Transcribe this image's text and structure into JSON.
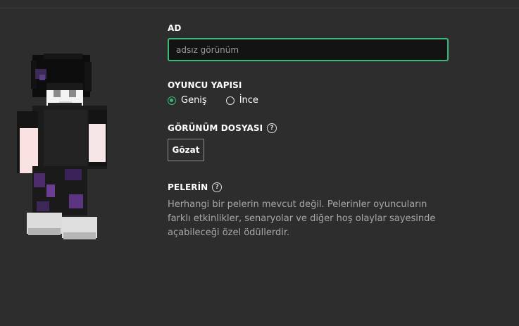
{
  "form": {
    "name_label": "AD",
    "name_placeholder": "adsız görünüm",
    "player_model_label": "OYUNCU YAPISI",
    "model_options": [
      {
        "label": "Geniş",
        "selected": true
      },
      {
        "label": "İnce",
        "selected": false
      }
    ],
    "skin_file_label": "GÖRÜNÜM DOSYASI",
    "browse_label": "Gözat",
    "cape_label": "PELERİN",
    "cape_description": "Herhangi bir pelerin mevcut değil. Pelerinler oyuncuların farklı etkinlikler, senaryolar ve diğer hoş olaylar sayesinde açabileceği özel ödüllerdir.",
    "help_glyph": "?"
  },
  "colors": {
    "background": "#2d2d2d",
    "accent": "#3cb878",
    "input_bg": "#131313",
    "muted_text": "#a8a8a8"
  }
}
